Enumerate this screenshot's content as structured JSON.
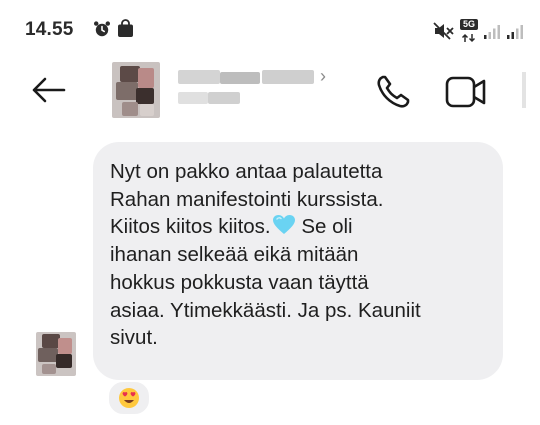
{
  "status_bar": {
    "time": "14.55",
    "icons": [
      "alarm-icon",
      "bag-icon",
      "mute-icon",
      "5g-icon",
      "signal-icon",
      "signal-icon"
    ],
    "network_badge": "5G"
  },
  "header": {
    "back_icon": "arrow-left-icon",
    "contact_name": "",
    "chevron": "›",
    "call_icon": "phone-icon",
    "video_icon": "video-icon"
  },
  "message": {
    "lines": [
      "Nyt on pakko antaa palautetta",
      "Rahan manifestointi kurssista.",
      "Kiitos kiitos kiitos.",
      "ihanan selkeää eikä mitään",
      "hokkus pokkusta vaan täyttä",
      "asiaa. Ytimekkäästi. Ja ps. Kauniit",
      "sivut."
    ],
    "line3_tail": " Se oli",
    "inline_emoji": "blue-heart-icon",
    "reaction": "heart-eyes-emoji-icon"
  },
  "colors": {
    "bubble": "#efeff1",
    "text": "#1f1f1f",
    "heart": "#6ad3f2",
    "reaction_face": "#ffc83d",
    "reaction_eyes": "#e8304f"
  }
}
